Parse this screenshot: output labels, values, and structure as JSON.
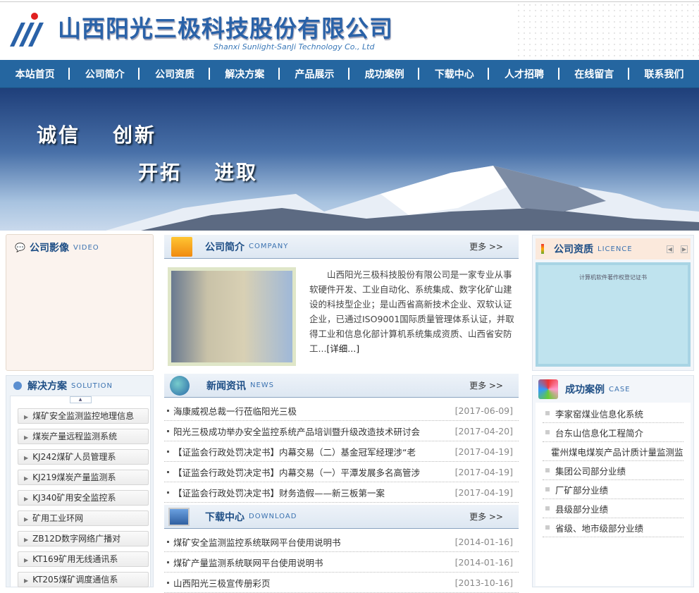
{
  "header": {
    "company_cn": "山西阳光三极科技股份有限公司",
    "company_en": "Shanxi Sunlight-SanJi Technology Co., Ltd"
  },
  "nav": [
    "本站首页",
    "公司简介",
    "公司资质",
    "解决方案",
    "产品展示",
    "成功案例",
    "下载中心",
    "人才招聘",
    "在线留言",
    "联系我们"
  ],
  "banner": {
    "slogan1": "诚信",
    "slogan2": "创新",
    "slogan3": "开拓",
    "slogan4": "进取"
  },
  "video": {
    "title": "公司影像",
    "en": "VIDEO"
  },
  "solution": {
    "title": "解决方案",
    "en": "SOLUTION",
    "items": [
      "煤矿安全监测监控地理信息",
      "煤炭产量远程监测系统",
      "KJ242煤矿人员管理系",
      "KJ219煤炭产量监测系",
      "KJ340矿用安全监控系",
      "矿用工业环网",
      "ZB12D数字网络广播对",
      "KT169矿用无线通讯系",
      "KT205煤矿调度通信系"
    ]
  },
  "company": {
    "title": "公司简介",
    "en": "COMPANY",
    "more": "更多 >>",
    "text": "山西阳光三极科技股份有限公司是一家专业从事软硬件开发、工业自动化、系统集成、数字化矿山建设的科技型企业；是山西省高新技术企业、双软认证企业，已通过ISO9001国际质量管理体系认证，并取得工业和信息化部计算机系统集成资质、山西省安防工...",
    "detail": "[详细...]"
  },
  "news": {
    "title": "新闻资讯",
    "en": "NEWS",
    "more": "更多 >>",
    "items": [
      {
        "t": "海康威视总裁一行莅临阳光三极",
        "d": "[2017-06-09]"
      },
      {
        "t": "阳光三极成功举办安全监控系统产品培训暨升级改造技术研讨会",
        "d": "[2017-04-20]"
      },
      {
        "t": "【证监会行政处罚决定书】内幕交易（二）基金冠军经理涉“老",
        "d": "[2017-04-19]"
      },
      {
        "t": "【证监会行政处罚决定书】内幕交易（一）平潭发展多名高管涉",
        "d": "[2017-04-19]"
      },
      {
        "t": "【证监会行政处罚决定书】财务造假——新三板第一案",
        "d": "[2017-04-19]"
      }
    ]
  },
  "download": {
    "title": "下载中心",
    "en": "DOWNLOAD",
    "more": "更多 >>",
    "items": [
      {
        "t": "煤矿安全监测监控系统联网平台使用说明书",
        "d": "[2014-01-16]"
      },
      {
        "t": "煤矿产量监测系统联网平台使用说明书",
        "d": "[2014-01-16]"
      },
      {
        "t": "山西阳光三极宣传册彩页",
        "d": "[2013-10-16]"
      }
    ]
  },
  "licence": {
    "title": "公司资质",
    "en": "LICENCE",
    "cert_title": "计算机软件著作权登记证书"
  },
  "cases": {
    "title": "成功案例",
    "en": "CASE",
    "items": [
      "李家窑煤业信息化系统",
      "台东山信息化工程简介",
      "霍州煤电煤炭产品计质计量监测监控系统",
      "集团公司部分业绩",
      "厂矿部分业绩",
      "县级部分业绩",
      "省级、地市级部分业绩"
    ]
  }
}
